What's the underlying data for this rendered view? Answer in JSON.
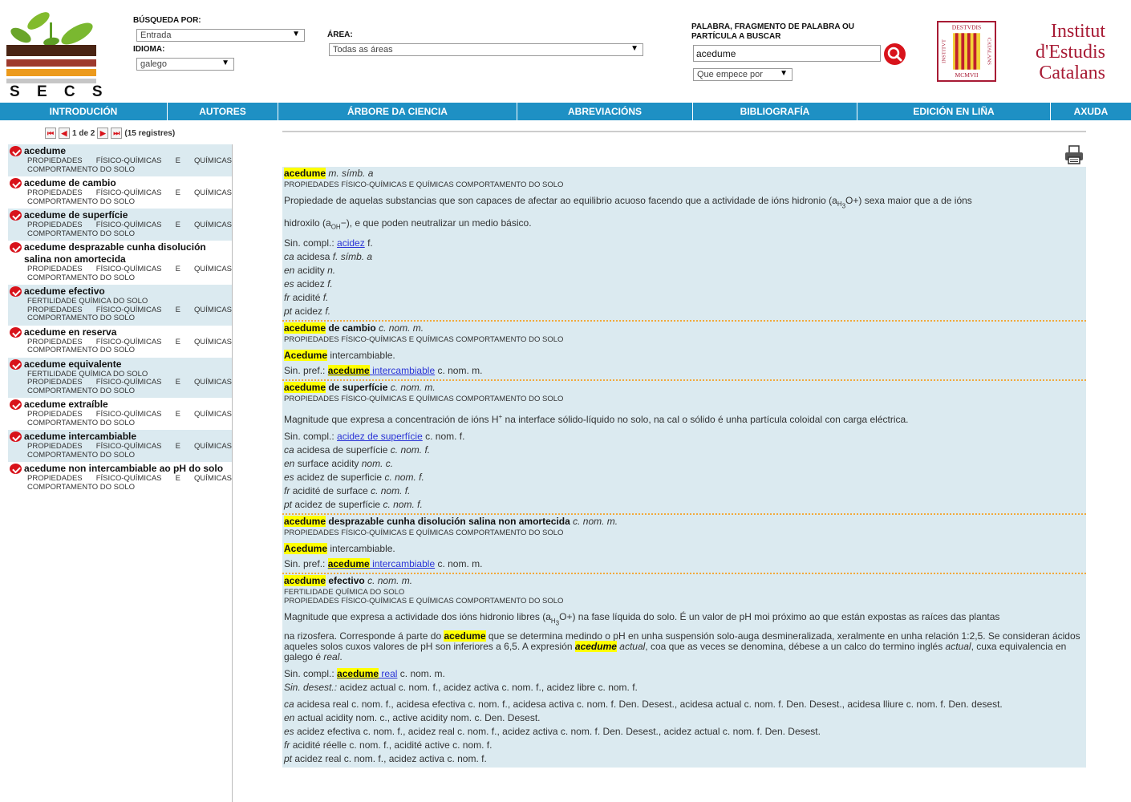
{
  "logo": {
    "text": "S E C S"
  },
  "search": {
    "busqueda_label": "BÚSQUEDA POR:",
    "busqueda_value": "Entrada",
    "idioma_label": "IDIOMA:",
    "idioma_value": "galego",
    "area_label": "ÁREA:",
    "area_value": "Todas as áreas",
    "term_label_1": "PALABRA, FRAGMENTO DE PALABRA OU",
    "term_label_2": "PARTÍCULA A BUSCAR",
    "term_value": "acedume",
    "mode_value": "Que empece por"
  },
  "institute": {
    "line1": "Institut",
    "line2": "d'Estudis",
    "line3": "Catalans",
    "seal_top": "DESTVDIS",
    "seal_left": "INSTITVT",
    "seal_right": "CATALANS",
    "seal_bottom": "MCMVII"
  },
  "nav": [
    "INTRODUCIÓN",
    "AUTORES",
    "ÁRBORE DA CIENCIA",
    "ABREVIACIÓNS",
    "BIBLIOGRAFÍA",
    "EDICIÓN EN LIÑA",
    "AXUDA"
  ],
  "pager": {
    "text": "1 de 2",
    "count": "(15 registres)"
  },
  "sidebar": [
    {
      "term": "acedume",
      "cats": [
        "PROPIEDADES FÍSICO-QUÍMICAS E QUÍMICAS COMPORTAMENTO DO SOLO"
      ]
    },
    {
      "term": "acedume de cambio",
      "cats": [
        "PROPIEDADES FÍSICO-QUÍMICAS E QUÍMICAS COMPORTAMENTO DO SOLO"
      ]
    },
    {
      "term": "acedume de superfície",
      "cats": [
        "PROPIEDADES FÍSICO-QUÍMICAS E QUÍMICAS COMPORTAMENTO DO SOLO"
      ]
    },
    {
      "term": "acedume desprazable cunha disolución salina non amortecida",
      "cats": [
        "PROPIEDADES FÍSICO-QUÍMICAS E QUÍMICAS COMPORTAMENTO DO SOLO"
      ]
    },
    {
      "term": "acedume efectivo",
      "cats": [
        "FERTILIDADE QUÍMICA DO SOLO",
        "PROPIEDADES FÍSICO-QUÍMICAS E QUÍMICAS COMPORTAMENTO DO SOLO"
      ]
    },
    {
      "term": "acedume en reserva",
      "cats": [
        "PROPIEDADES FÍSICO-QUÍMICAS E QUÍMICAS COMPORTAMENTO DO SOLO"
      ]
    },
    {
      "term": "acedume equivalente",
      "cats": [
        "FERTILIDADE QUÍMICA DO SOLO",
        "PROPIEDADES FÍSICO-QUÍMICAS E QUÍMICAS COMPORTAMENTO DO SOLO"
      ]
    },
    {
      "term": "acedume extraíble",
      "cats": [
        "PROPIEDADES FÍSICO-QUÍMICAS E QUÍMICAS COMPORTAMENTO DO SOLO"
      ]
    },
    {
      "term": "acedume intercambiable",
      "cats": [
        "PROPIEDADES FÍSICO-QUÍMICAS E QUÍMICAS COMPORTAMENTO DO SOLO"
      ]
    },
    {
      "term": "acedume non intercambiable ao pH do solo",
      "cats": [
        "PROPIEDADES FÍSICO-QUÍMICAS E QUÍMICAS COMPORTAMENTO DO SOLO"
      ]
    }
  ],
  "entries": {
    "e1": {
      "word": "acedume",
      "gram": "m. símb. a",
      "cat": "PROPIEDADES FÍSICO-QUÍMICAS E QUÍMICAS COMPORTAMENTO DO SOLO",
      "def_a": "Propiedade de aquelas substancias que son capaces de afectar ao equilibrio acuoso facendo que a actividade de ións hidronio (a",
      "def_sub1": "H",
      "def_sub2": "3",
      "def_b": "O+) sexa maior que a de ións",
      "def2_a": "hidroxilo (a",
      "def2_sub": "OH",
      "def2_b": "−), e que poden neutralizar un medio básico.",
      "sin_label": "Sin. compl.:",
      "sin_link": "acidez",
      "sin_gram": "f.",
      "tr": [
        {
          "lang": "ca",
          "text": "acidesa",
          "gram": "f. símb. a"
        },
        {
          "lang": "en",
          "text": "acidity",
          "gram": "n."
        },
        {
          "lang": "es",
          "text": "acidez",
          "gram": "f."
        },
        {
          "lang": "fr",
          "text": "acidité",
          "gram": "f."
        },
        {
          "lang": "pt",
          "text": "acidez",
          "gram": "f."
        }
      ]
    },
    "e2": {
      "word": "acedume",
      "rest": "de cambio",
      "gram": "c. nom. m.",
      "cat": "PROPIEDADES FÍSICO-QUÍMICAS E QUÍMICAS COMPORTAMENTO DO SOLO",
      "def_hl": "Acedume",
      "def_rest": "intercambiable.",
      "sin_label": "Sin. pref.:",
      "sin_hl": "acedume",
      "sin_link": "intercambiable",
      "sin_gram": "c. nom. m."
    },
    "e3": {
      "word": "acedume",
      "rest": "de superfície",
      "gram": "c. nom. m.",
      "cat": "PROPIEDADES FÍSICO-QUÍMICAS E QUÍMICAS COMPORTAMENTO DO SOLO",
      "def_a": "Magnitude que expresa a concentración de ións H",
      "def_sup": "+",
      "def_b": "na interface sólido-líquido no solo, na cal o sólido é unha partícula coloidal con carga eléctrica.",
      "sin_label": "Sin. compl.:",
      "sin_link": "acidez de superfície",
      "sin_gram": "c. nom. f.",
      "tr": [
        {
          "lang": "ca",
          "text": "acidesa de superfície",
          "gram": "c. nom. f."
        },
        {
          "lang": "en",
          "text": "surface acidity",
          "gram": "nom. c."
        },
        {
          "lang": "es",
          "text": "acidez de superficie",
          "gram": "c. nom. f."
        },
        {
          "lang": "fr",
          "text": "acidité de surface",
          "gram": "c. nom. f."
        },
        {
          "lang": "pt",
          "text": "acidez de superfície",
          "gram": "c. nom. f."
        }
      ]
    },
    "e4": {
      "word": "acedume",
      "rest": "desprazable cunha disolución salina non amortecida",
      "gram": "c. nom. m.",
      "cat": "PROPIEDADES FÍSICO-QUÍMICAS E QUÍMICAS COMPORTAMENTO DO SOLO",
      "def_hl": "Acedume",
      "def_rest": "intercambiable.",
      "sin_label": "Sin. pref.:",
      "sin_hl": "acedume",
      "sin_link": "intercambiable",
      "sin_gram": "c. nom. m."
    },
    "e5": {
      "word": "acedume",
      "rest": "efectivo",
      "gram": "c. nom. m.",
      "cat1": "FERTILIDADE QUÍMICA DO SOLO",
      "cat2": "PROPIEDADES FÍSICO-QUÍMICAS E QUÍMICAS COMPORTAMENTO DO SOLO",
      "def_a": "Magnitude que expresa a actividade dos ións hidronio libres (a",
      "def_sub1": "H",
      "def_sub2": "3",
      "def_b": "O+) na fase líquida do solo. É un valor de pH moi próximo ao que están expostas as raíces das plantas",
      "def2_a": "na rizosfera. Corresponde á parte do",
      "def2_hl": "acedume",
      "def2_b": "que se determina medindo o pH en unha suspensión solo-auga desmineralizada, xeralmente en unha relación 1:2,5. Se consideran ácidos aqueles solos cuxos valores de pH son inferiores a 6,5. A expresión",
      "def2_hl2": "acedume",
      "def2_it": "actual",
      "def2_c": ", coa que as veces se denomina, débese a un calco do termino inglés",
      "def2_it2": "actual",
      "def2_d": ", cuxa equivalencia en galego é",
      "def2_it3": "real",
      "def2_e": ".",
      "sin_label": "Sin. compl.:",
      "sin_hl": "acedume",
      "sin_link": "real",
      "sin_gram": "c. nom. m.",
      "desest_label": "Sin. desest.:",
      "desest_text": "acidez actual c. nom. f., acidez activa c. nom. f., acidez libre c. nom. f.",
      "tr": [
        {
          "lang": "ca",
          "text": "acidesa real c. nom. f., acidesa efectiva c. nom. f., acidesa activa c. nom. f. Den. Desest., acidesa actual c. nom. f. Den. Desest., acidesa lliure c. nom. f. Den. desest."
        },
        {
          "lang": "en",
          "text": "actual acidity nom. c., active acidity nom. c. Den. Desest."
        },
        {
          "lang": "es",
          "text": "acidez efectiva c. nom. f., acidez real c. nom. f., acidez activa c. nom. f. Den. Desest., acidez actual c. nom. f. Den. Desest."
        },
        {
          "lang": "fr",
          "text": "acidité réelle c. nom. f., acidité active c. nom. f."
        },
        {
          "lang": "pt",
          "text": "acidez real c. nom. f., acidez activa c. nom. f."
        }
      ]
    }
  }
}
